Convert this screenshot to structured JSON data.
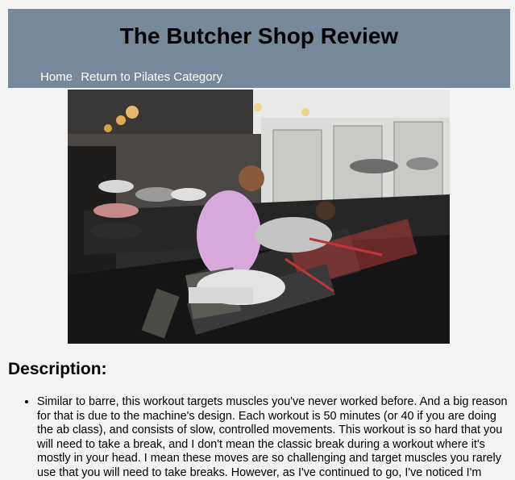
{
  "header": {
    "title": "The Butcher Shop Review",
    "nav": [
      {
        "label": "Home"
      },
      {
        "label": "Return to Pilates Category"
      }
    ]
  },
  "hero_image": {
    "icon": "pilates-class-photo"
  },
  "description": {
    "heading": "Description:",
    "items": [
      "Similar to barre, this workout targets muscles you've never worked before. And a big reason for that is due to the machine's design. Each workout is 50 minutes (or 40 if you are doing the ab class), and consists of slow, controlled movements. This workout is so hard that you will need to take a break, and I don't mean the classic break during a workout where it's mostly in your head. I mean these moves are so challenging and target muscles you rarely use that you will need to take breaks. However, as I've continued to go, I've noticed I'm"
    ]
  },
  "colors": {
    "header_bg": "#778899",
    "page_bg": "#f3f3f3",
    "nav_text": "#ffffff"
  }
}
